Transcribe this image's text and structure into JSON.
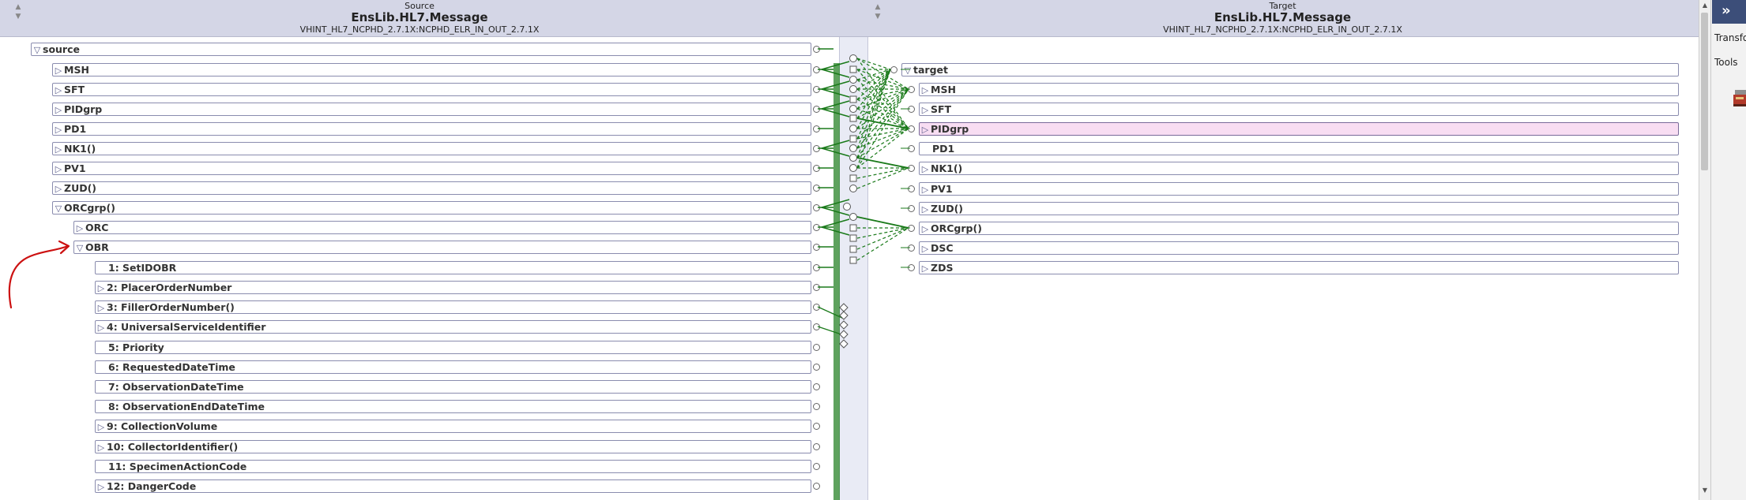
{
  "source": {
    "kind": "Source",
    "class_name": "EnsLib.HL7.Message",
    "schema": "VHINT_HL7_NCPHD_2.7.1X:NCPHD_ELR_IN_OUT_2.7.1X",
    "nodes": [
      {
        "label": "source",
        "expanded": true
      },
      {
        "label": "MSH",
        "expanded": false
      },
      {
        "label": "SFT",
        "expanded": false
      },
      {
        "label": "PIDgrp",
        "expanded": false
      },
      {
        "label": "PD1",
        "expanded": false
      },
      {
        "label": "NK1()",
        "expanded": false
      },
      {
        "label": "PV1",
        "expanded": false
      },
      {
        "label": "ZUD()",
        "expanded": false
      },
      {
        "label": "ORCgrp()",
        "expanded": true
      },
      {
        "label": "ORC",
        "expanded": false
      },
      {
        "label": "OBR",
        "expanded": true
      },
      {
        "label": "1: SetIDOBR"
      },
      {
        "label": "2: PlacerOrderNumber",
        "expanded": false
      },
      {
        "label": "3: FillerOrderNumber()",
        "expanded": false
      },
      {
        "label": "4: UniversalServiceIdentifier",
        "expanded": false
      },
      {
        "label": "5: Priority"
      },
      {
        "label": "6: RequestedDateTime"
      },
      {
        "label": "7: ObservationDateTime"
      },
      {
        "label": "8: ObservationEndDateTime"
      },
      {
        "label": "9: CollectionVolume",
        "expanded": false
      },
      {
        "label": "10: CollectorIdentifier()",
        "expanded": false
      },
      {
        "label": "11: SpecimenActionCode"
      },
      {
        "label": "12: DangerCode",
        "expanded": false
      }
    ]
  },
  "target": {
    "kind": "Target",
    "class_name": "EnsLib.HL7.Message",
    "schema": "VHINT_HL7_NCPHD_2.7.1X:NCPHD_ELR_IN_OUT_2.7.1X",
    "nodes": [
      {
        "label": "target",
        "expanded": true
      },
      {
        "label": "MSH",
        "expanded": false
      },
      {
        "label": "SFT",
        "expanded": false
      },
      {
        "label": "PIDgrp",
        "expanded": false,
        "selected": true
      },
      {
        "label": "PD1"
      },
      {
        "label": "NK1()",
        "expanded": false
      },
      {
        "label": "PV1",
        "expanded": false
      },
      {
        "label": "ZUD()",
        "expanded": false
      },
      {
        "label": "ORCgrp()",
        "expanded": false
      },
      {
        "label": "DSC",
        "expanded": false
      },
      {
        "label": "ZDS",
        "expanded": false
      }
    ]
  },
  "sidebar": {
    "collapse_label": "»",
    "tab_transform": "Transfo",
    "tab_tools": "Tools",
    "toolbox_icon": "toolbox-icon"
  },
  "colors": {
    "header_bg": "#d4d6e6",
    "link_green": "#1a7a1a",
    "selected_bg": "#f8ddf2",
    "annotation_red": "#cc1111"
  }
}
